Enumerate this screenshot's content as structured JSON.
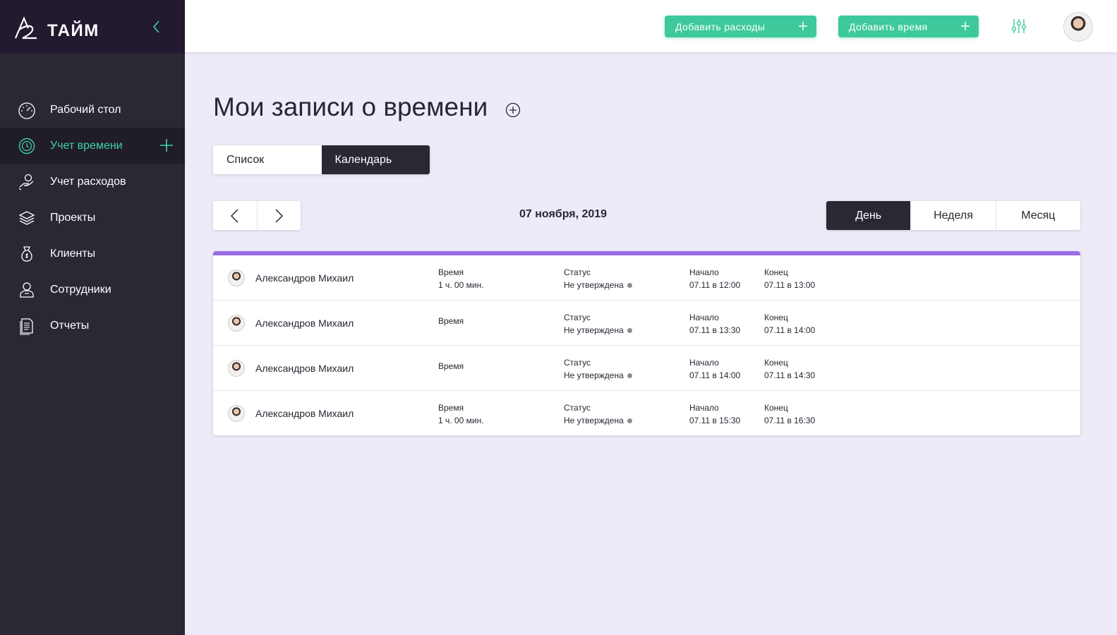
{
  "app": {
    "logo_text": "ТАЙМ",
    "logo_mark": "A2"
  },
  "sidebar": {
    "items": [
      {
        "label": "Рабочий стол",
        "icon": "dashboard-gauge-icon"
      },
      {
        "label": "Учет времени",
        "icon": "clock-icon",
        "active": true
      },
      {
        "label": "Учет расходов",
        "icon": "hand-coin-icon"
      },
      {
        "label": "Проекты",
        "icon": "layers-icon"
      },
      {
        "label": "Клиенты",
        "icon": "money-bag-icon"
      },
      {
        "label": "Сотрудники",
        "icon": "person-icon"
      },
      {
        "label": "Отчеты",
        "icon": "document-icon"
      }
    ]
  },
  "topbar": {
    "add_expense_label": "Добавить расходы",
    "add_time_label": "Добавить время"
  },
  "page": {
    "title": "Мои записи о времени"
  },
  "view_toggle": {
    "list_label": "Список",
    "calendar_label": "Календарь",
    "selected": "Календарь"
  },
  "navigation": {
    "current_date": "07 ноября, 2019"
  },
  "range_toggle": {
    "day_label": "День",
    "week_label": "Неделя",
    "month_label": "Месяц",
    "selected": "День"
  },
  "records": {
    "time_header": "Время",
    "status_header": "Статус",
    "start_header": "Начало",
    "end_header": "Конец",
    "rows": [
      {
        "name": "Александров Михаил",
        "time": "1 ч. 00 мин.",
        "status": "Не утверждена",
        "start": "07.11 в 12:00",
        "end": "07.11 в 13:00"
      },
      {
        "name": "Александров Михаил",
        "time": "",
        "status": "Не утверждена",
        "start": "07.11 в 13:30",
        "end": "07.11 в 14:00"
      },
      {
        "name": "Александров Михаил",
        "time": "",
        "status": "Не утверждена",
        "start": "07.11 в 14:00",
        "end": "07.11 в 14:30"
      },
      {
        "name": "Александров Михаил",
        "time": "1 ч. 00 мин.",
        "status": "Не утверждена",
        "start": "07.11 в 15:30",
        "end": "07.11 в 16:30"
      }
    ]
  },
  "colors": {
    "accent_green": "#3ec99d",
    "accent_purple": "#9b6be6",
    "sidebar_bg": "#2b2733",
    "page_bg": "#eeebf8"
  }
}
